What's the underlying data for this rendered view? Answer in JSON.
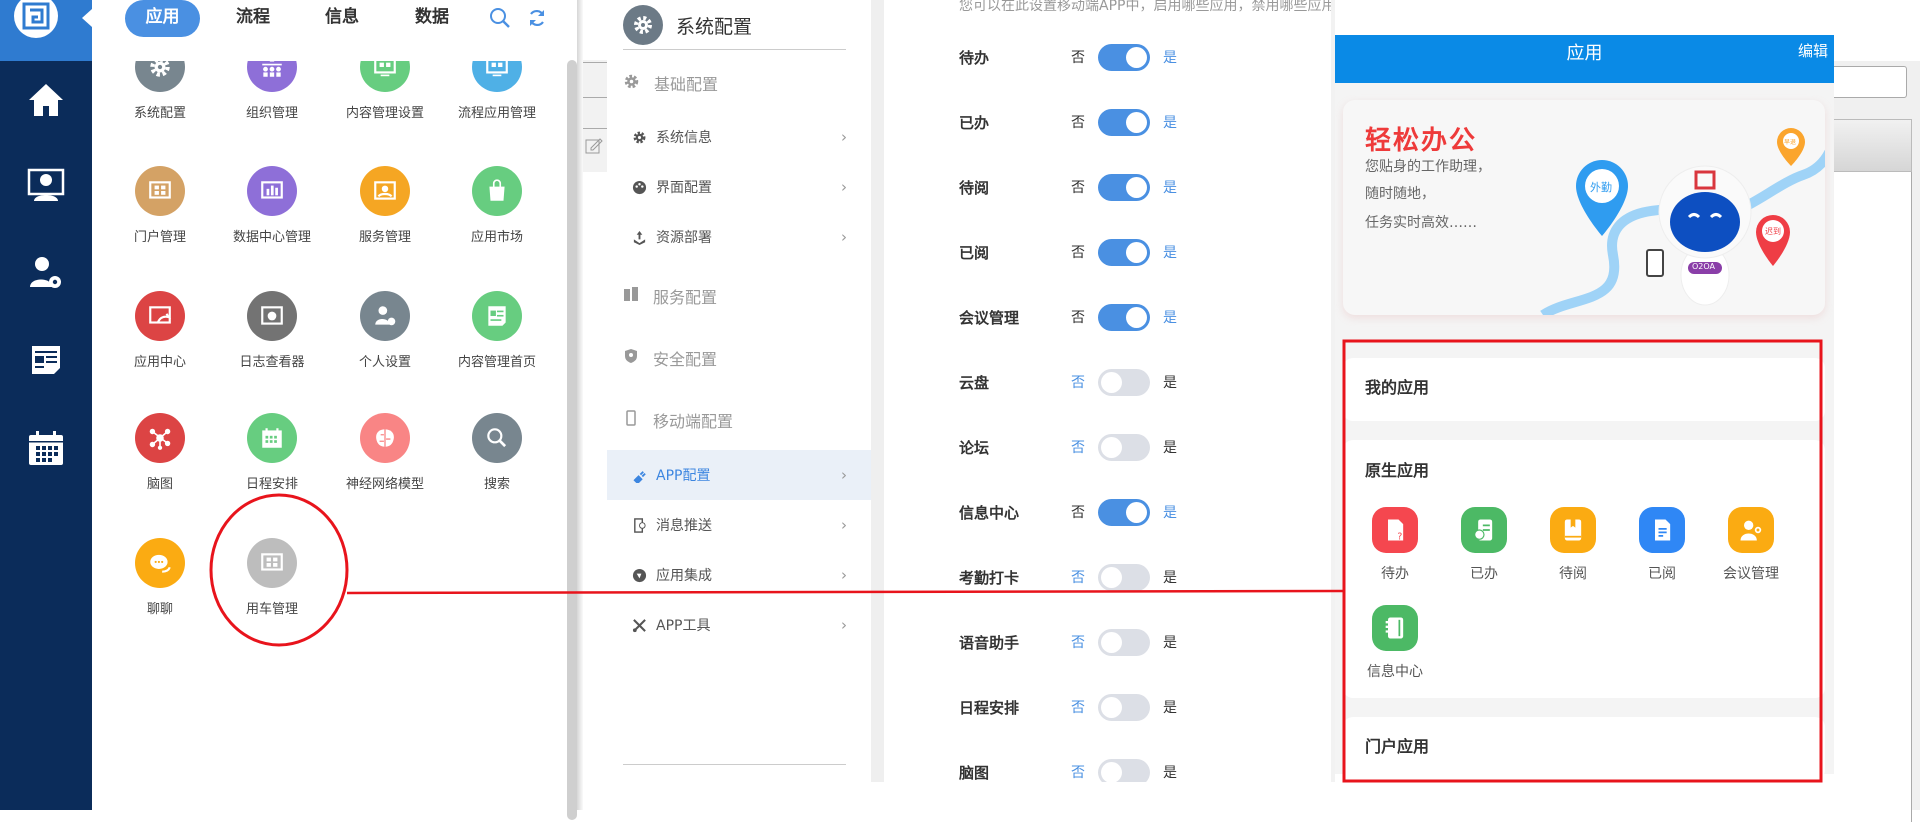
{
  "left_nav": {
    "items": [
      {
        "name": "home"
      },
      {
        "name": "monitor-user"
      },
      {
        "name": "user-settings"
      },
      {
        "name": "news"
      },
      {
        "name": "calendar"
      }
    ]
  },
  "app_panel": {
    "tabs": [
      {
        "label": "应用",
        "active": true
      },
      {
        "label": "流程"
      },
      {
        "label": "信息"
      },
      {
        "label": "数据"
      }
    ],
    "apps": [
      {
        "label": "系统配置",
        "color": "#78868f",
        "icon": "gear"
      },
      {
        "label": "组织管理",
        "color": "#8e6fd8",
        "icon": "org"
      },
      {
        "label": "内容管理设置",
        "color": "#67cd80",
        "icon": "monitor"
      },
      {
        "label": "流程应用管理",
        "color": "#4fb0e6",
        "icon": "monitor"
      },
      {
        "label": "门户管理",
        "color": "#d4a265",
        "icon": "grid"
      },
      {
        "label": "数据中心管理",
        "color": "#8e6fd8",
        "icon": "chart"
      },
      {
        "label": "服务管理",
        "color": "#f5a623",
        "icon": "service"
      },
      {
        "label": "应用市场",
        "color": "#67cd80",
        "icon": "bag"
      },
      {
        "label": "应用中心",
        "color": "#dc4444",
        "icon": "window"
      },
      {
        "label": "日志查看器",
        "color": "#737373",
        "icon": "log"
      },
      {
        "label": "个人设置",
        "color": "#78868f",
        "icon": "user"
      },
      {
        "label": "内容管理首页",
        "color": "#67cd80",
        "icon": "news"
      },
      {
        "label": "脑图",
        "color": "#dc4444",
        "icon": "mindmap"
      },
      {
        "label": "日程安排",
        "color": "#67cd80",
        "icon": "calendar"
      },
      {
        "label": "神经网络模型",
        "color": "#f98585",
        "icon": "brain"
      },
      {
        "label": "搜索",
        "color": "#78868f",
        "icon": "search"
      },
      {
        "label": "聊聊",
        "color": "#fbab12",
        "icon": "chat"
      },
      {
        "label": "用车管理",
        "color": "#bdbdbd",
        "icon": "grid"
      }
    ]
  },
  "settings": {
    "title": "系统配置",
    "groups": [
      {
        "label": "基础配置",
        "icon": "gear",
        "items": [
          {
            "label": "系统信息",
            "icon": "gear"
          },
          {
            "label": "界面配置",
            "icon": "palette"
          },
          {
            "label": "资源部署",
            "icon": "upload"
          }
        ]
      },
      {
        "label": "服务配置",
        "icon": "server",
        "items": []
      },
      {
        "label": "安全配置",
        "icon": "shield",
        "items": []
      },
      {
        "label": "移动端配置",
        "icon": "mobile",
        "items": [
          {
            "label": "APP配置",
            "icon": "plug",
            "active": true
          },
          {
            "label": "消息推送",
            "icon": "push"
          },
          {
            "label": "应用集成",
            "icon": "integration"
          },
          {
            "label": "APP工具",
            "icon": "tools"
          }
        ]
      }
    ]
  },
  "main": {
    "description": "您可以在此设置移动端APP中，启用哪些应用，禁用哪些应用",
    "no_label": "否",
    "yes_label": "是",
    "toggles": [
      {
        "label": "待办",
        "enabled": true
      },
      {
        "label": "已办",
        "enabled": true
      },
      {
        "label": "待阅",
        "enabled": true
      },
      {
        "label": "已阅",
        "enabled": true
      },
      {
        "label": "会议管理",
        "enabled": true
      },
      {
        "label": "云盘",
        "enabled": false
      },
      {
        "label": "论坛",
        "enabled": false
      },
      {
        "label": "信息中心",
        "enabled": true
      },
      {
        "label": "考勤打卡",
        "enabled": false
      },
      {
        "label": "语音助手",
        "enabled": false
      },
      {
        "label": "日程安排",
        "enabled": false
      },
      {
        "label": "脑图",
        "enabled": false
      }
    ]
  },
  "phone": {
    "title": "应用",
    "edit": "编辑",
    "banner": {
      "headline": "轻松办公",
      "lines": [
        "您贴身的工作助理，",
        "随时随地，",
        "任务实时高效……"
      ],
      "pin_labels": [
        "外勤",
        "早退",
        "迟到"
      ],
      "robot_badge": "O2OA"
    },
    "sections": {
      "my_apps": "我的应用",
      "native_apps": "原生应用",
      "portal_apps": "门户应用"
    },
    "native_apps": [
      {
        "label": "待办",
        "color": "#f5474f",
        "icon": "todo"
      },
      {
        "label": "已办",
        "color": "#4cb965",
        "icon": "done"
      },
      {
        "label": "待阅",
        "color": "#fbab12",
        "icon": "book"
      },
      {
        "label": "已阅",
        "color": "#2f87f5",
        "icon": "doc"
      },
      {
        "label": "会议管理",
        "color": "#fbab12",
        "icon": "meeting"
      },
      {
        "label": "信息中心",
        "color": "#4cb965",
        "icon": "notebook"
      }
    ]
  },
  "colors": {
    "accent": "#4a90e2",
    "nav_bg": "#0b2c5a",
    "annotation": "#e8141c"
  }
}
